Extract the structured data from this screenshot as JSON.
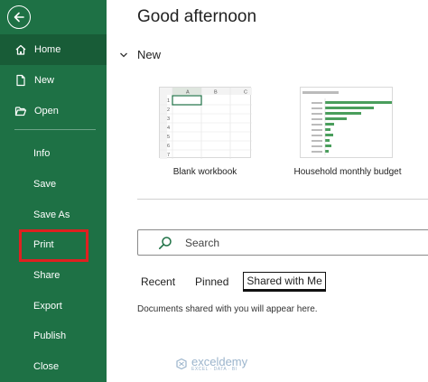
{
  "sidebar": {
    "items": [
      {
        "label": "Home",
        "icon": "home-icon"
      },
      {
        "label": "New",
        "icon": "new-file-icon"
      },
      {
        "label": "Open",
        "icon": "open-folder-icon"
      },
      {
        "label": "Info"
      },
      {
        "label": "Save"
      },
      {
        "label": "Save As"
      },
      {
        "label": "Print"
      },
      {
        "label": "Share"
      },
      {
        "label": "Export"
      },
      {
        "label": "Publish"
      },
      {
        "label": "Close"
      }
    ],
    "active": "Home",
    "highlighted": "Print"
  },
  "main": {
    "greeting": "Good afternoon",
    "new_section": "New",
    "templates": [
      {
        "label": "Blank workbook"
      },
      {
        "label": "Household monthly budget"
      }
    ],
    "search_placeholder": "Search",
    "tabs": [
      {
        "label": "Recent"
      },
      {
        "label": "Pinned"
      },
      {
        "label": "Shared with Me",
        "active": true
      }
    ],
    "message": "Documents shared with you will appear here."
  },
  "watermark": {
    "name": "exceldemy",
    "tagline": "EXCEL · DATA · BI"
  },
  "colors": {
    "sidebar_bg": "#1e7145",
    "sidebar_active": "#185c37",
    "highlight_border": "#e02020",
    "budget_bars": "#4a9e5c"
  }
}
